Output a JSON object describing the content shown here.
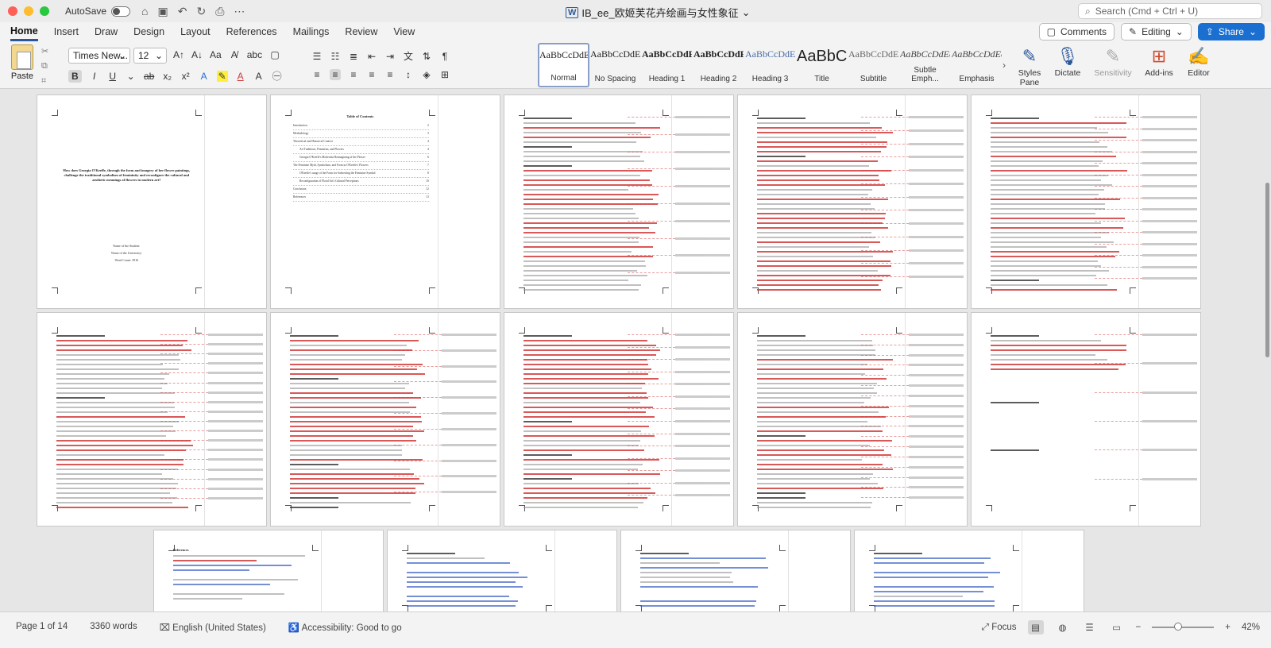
{
  "window": {
    "autosave_label": "AutoSave",
    "title": "IB_ee_欧姬芙花卉绘画与女性象征",
    "search_placeholder": "Search (Cmd + Ctrl + U)"
  },
  "menu": {
    "tabs": [
      "Home",
      "Insert",
      "Draw",
      "Design",
      "Layout",
      "References",
      "Mailings",
      "Review",
      "View"
    ],
    "comments_label": "Comments",
    "editing_label": "Editing",
    "share_label": "Share"
  },
  "ribbon": {
    "paste_label": "Paste",
    "font_name": "Times New...",
    "font_size": "12",
    "styles": [
      {
        "preview": "AaBbCcDdE",
        "name": "Normal"
      },
      {
        "preview": "AaBbCcDdE",
        "name": "No Spacing"
      },
      {
        "preview": "AaBbCcDdE",
        "name": "Heading 1"
      },
      {
        "preview": "AaBbCcDdE",
        "name": "Heading 2"
      },
      {
        "preview": "AaBbCcDdEe",
        "name": "Heading 3"
      },
      {
        "preview": "AaBbC",
        "name": "Title"
      },
      {
        "preview": "AaBbCcDdEe",
        "name": "Subtitle"
      },
      {
        "preview": "AaBbCcDdEe",
        "name": "Subtle Emph..."
      },
      {
        "preview": "AaBbCcDdEe",
        "name": "Emphasis"
      }
    ],
    "styles_pane_label": "Styles Pane",
    "dictate_label": "Dictate",
    "sensitivity_label": "Sensitivity",
    "addins_label": "Add-ins",
    "editor_label": "Editor"
  },
  "document": {
    "cover_title": "How does Georgia O'Keeffe, through the form and imagery of her flower paintings, challenge the traditional symbolism of femininity and reconfigure the cultural and aesthetic meanings of flowers in modern art?",
    "cover_info": [
      "Name of the Student:",
      "Name of the University:",
      "Word Count: 3916"
    ],
    "toc_title": "Table of Contents",
    "toc_items": [
      {
        "label": "Introduction",
        "page": "2"
      },
      {
        "label": "Methodology",
        "page": "3"
      },
      {
        "label": "Theoretical and Historical Context",
        "page": "4"
      },
      {
        "label": "Art Traditions, Feminism, and Flowers",
        "page": "4"
      },
      {
        "label": "Georgia O'Keeffe's Modernist Reimagining of the Flower",
        "page": "6"
      },
      {
        "label": "The Feminine Myth, Symbolism, and Form in O'Keeffe's Flowers",
        "page": "7"
      },
      {
        "label": "O'Keeffe's usage of the Form for Subverting the Feminine Symbol",
        "page": "8"
      },
      {
        "label": "Reconfiguration of Floral Art's Cultural Perceptions",
        "page": "10"
      },
      {
        "label": "Conclusion",
        "page": "12"
      },
      {
        "label": "References",
        "page": "13"
      }
    ],
    "references_heading": "References"
  },
  "status": {
    "page_info": "Page 1 of 14",
    "word_count": "3360 words",
    "language": "English (United States)",
    "accessibility": "Accessibility: Good to go",
    "focus_label": "Focus",
    "zoom": "42%",
    "zoom_fraction": 0.42
  }
}
